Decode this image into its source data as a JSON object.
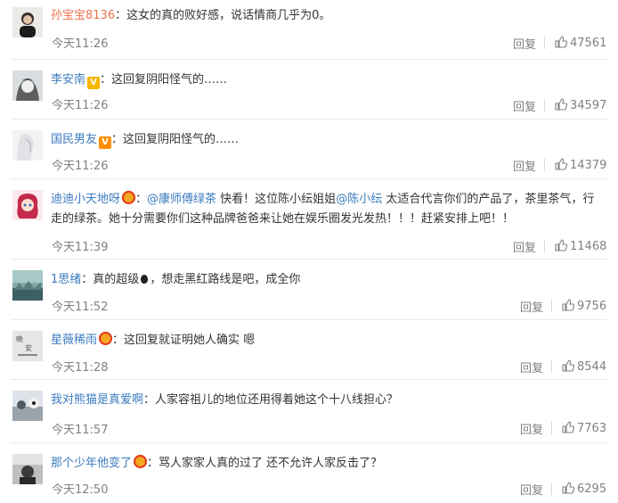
{
  "comments": [
    {
      "username": "孙宝宝8136",
      "badge": "",
      "text": "这女的真的败好感，说话情商几乎为0。",
      "time": "今天11:26",
      "reply": "回复",
      "likes": "47561"
    },
    {
      "username": "李安南",
      "badge": "v-yellow",
      "text": "这回复阴阳怪气的……",
      "time": "今天11:26",
      "reply": "回复",
      "likes": "34597"
    },
    {
      "username": "国民男友",
      "badge": "v-orange",
      "text": "这回复阴阳怪气的……",
      "time": "今天11:26",
      "reply": "回复",
      "likes": "14379"
    },
    {
      "username": "迪迪小天地呀",
      "badge": "member",
      "text_prefix": "",
      "mention1": "@康师傅绿茶",
      "text_mid": " 快看！这位陈小纭姐姐",
      "mention2": "@陈小纭",
      "text_suffix": " 太适合代言你们的产品了，茶里茶气，行走的绿茶。她十分需要你们这种品牌爸爸来让她在娱乐圈发光发热！！！赶紧安排上吧！！",
      "time": "今天11:39",
      "reply": "回复",
      "likes": "11468"
    },
    {
      "username": "1思绪",
      "badge": "",
      "text_before": "真的超级",
      "text_after": "，想走黑红路线是吧，成全你",
      "time": "今天11:52",
      "reply": "回复",
      "likes": "9756"
    },
    {
      "username": "星薇稀雨",
      "badge": "member",
      "text": "这回复就证明她人确实 嗯",
      "time": "今天11:28",
      "reply": "回复",
      "likes": "8544"
    },
    {
      "username": "我对熊猫是真爱啊",
      "badge": "",
      "text": "人家容祖儿的地位还用得着她这个十八线担心？",
      "time": "今天11:57",
      "reply": "回复",
      "likes": "7763"
    },
    {
      "username": "那个少年他变了",
      "badge": "member",
      "text": "骂人家家人真的过了 还不允许人家反击了？",
      "time": "今天12:50",
      "reply": "回复",
      "likes": "6295"
    }
  ],
  "colors": {
    "username": "#eb7350",
    "mention": "#3b7bbf",
    "meta": "#808080"
  }
}
